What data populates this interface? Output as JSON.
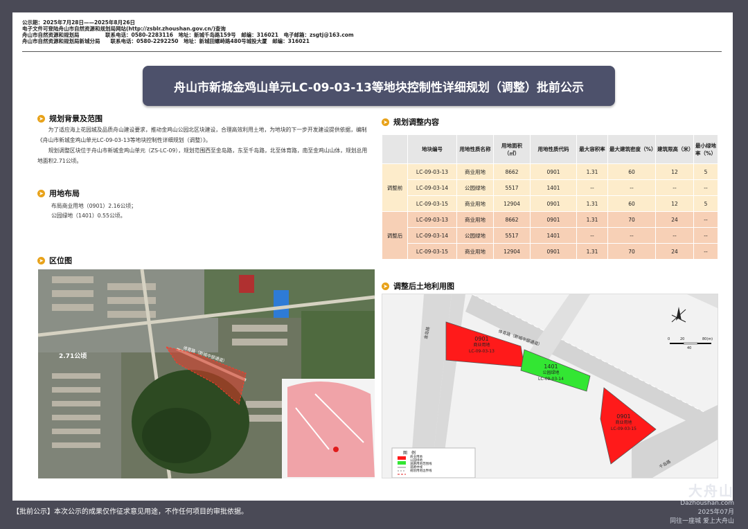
{
  "notice": {
    "line1": "公示期：2025年7月28日——2025年8月26日",
    "line2": "电子文件可登陆舟山市自然资源和规划局网站(http://zsblr.zhoushan.gov.cn/)查询",
    "line3": "舟山市自然资源和规划局　　　　　联系电话：0580-2283116　地址：新城千岛路159号　邮编：316021　电子邮箱：zsgtj@163.com",
    "line4": "舟山市自然资源和规划局新城分局　　联系电话：0580-2292250　地址：新城田螺峙路480号城投大厦　邮编：316021"
  },
  "title": "舟山市新城金鸡山单元LC-09-03-13等地块控制性详细规划（调整）批前公示",
  "sections": {
    "background": {
      "heading": "规划背景及范围",
      "p1": "为了适应海上花园城及品质舟山建设要求，推动金鸡山公园北区块建设，合理高效利用土地，为地块的下一步开发建设提供依据，编制《舟山市新城金鸡山单元LC-09-03-13等地块控制性详细规划（调整）》。",
      "p2": "规划调整区块位于舟山市新城金鸡山单元（ZS-LC-09），规划范围西至金岛路，东至千岛路，北至体育路，南至金鸡山山体，规划总用地面积2.71公顷。"
    },
    "layout": {
      "heading": "用地布局",
      "l1": "布局商业用地（0901）2.16公顷；",
      "l2": "公园绿地（1401）0.55公顷。"
    },
    "location": {
      "heading": "区位图"
    },
    "content": {
      "heading": "规划调整内容"
    },
    "landuse": {
      "heading": "调整后土地利用图"
    }
  },
  "table": {
    "headers": [
      "",
      "地块编号",
      "用地性质名称",
      "用地面积（㎡）",
      "用地性质代码",
      "最大容积率",
      "最大建筑密度（%）",
      "建筑限高（米）",
      "最小绿地率（%）"
    ],
    "groups": [
      {
        "label": "调整前",
        "rows": [
          [
            "LC-09-03-13",
            "商业用地",
            "8662",
            "0901",
            "1.31",
            "60",
            "12",
            "5"
          ],
          [
            "LC-09-03-14",
            "公园绿地",
            "5517",
            "1401",
            "--",
            "--",
            "--",
            "--"
          ],
          [
            "LC-09-03-15",
            "商业用地",
            "12904",
            "0901",
            "1.31",
            "60",
            "12",
            "5"
          ]
        ]
      },
      {
        "label": "调整后",
        "rows": [
          [
            "LC-09-03-13",
            "商业用地",
            "8662",
            "0901",
            "1.31",
            "70",
            "24",
            "--"
          ],
          [
            "LC-09-03-14",
            "公园绿地",
            "5517",
            "1401",
            "--",
            "--",
            "--",
            "--"
          ],
          [
            "LC-09-03-15",
            "商业用地",
            "12904",
            "0901",
            "1.31",
            "70",
            "24",
            "--"
          ]
        ]
      }
    ]
  },
  "map1": {
    "area_label": "2.71公顷",
    "road_label": "体育路（新城中部通道）"
  },
  "map2": {
    "road_north": "体育路（新城中部通道）",
    "road_west": "金岛路",
    "road_east": "千岛路",
    "parcel13": {
      "code": "0901",
      "name": "商业用地",
      "id": "LC-09-03-13"
    },
    "parcel14": {
      "code": "1401",
      "name": "公园绿地",
      "id": "LC-09-03-14"
    },
    "parcel15": {
      "code": "0901",
      "name": "商业用地",
      "id": "LC-09-03-15"
    },
    "scale_labels": [
      "0",
      "20",
      "40",
      "80(m)"
    ],
    "legend_title": "图　例",
    "legend_items": [
      "商业用地",
      "公园绿地",
      "道路用地范围线",
      "道路中线",
      "规划用地边界线"
    ]
  },
  "footer": "【批前公示】本次公示的成果仅作征求意见用途，不作任何项目的审批依据。",
  "watermark": {
    "brand": "大舟山",
    "site": "Dazhoushan.com",
    "date": "2025年07月",
    "slogan": "同往一座城 爱上大舟山"
  },
  "colors": {
    "commercial": "#ff1a1a",
    "green": "#33e633",
    "header": "#4d516b",
    "pre": "#fdeccb",
    "post": "#f7d0b6",
    "accent": "#e8a21a"
  }
}
